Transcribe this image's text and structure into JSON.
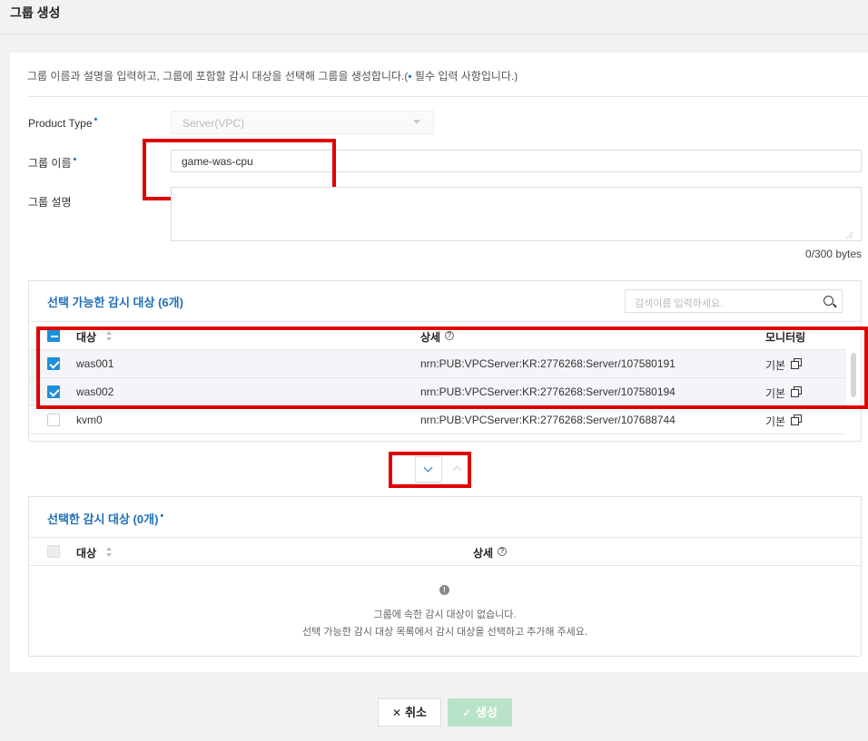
{
  "page": {
    "title": "그룹 생성",
    "description": "그룹 이름과 설명을 입력하고, 그룹에 포함할 감시 대상을 선택해 그룹을 생성합니다.(",
    "description_dot": "•",
    "description_tail": " 필수 입력 사항입니다.)"
  },
  "form": {
    "product_type_label": "Product Type",
    "product_type_value": "Server(VPC)",
    "group_name_label": "그룹 이름",
    "group_name_value": "game-was-cpu",
    "group_desc_label": "그룹 설명",
    "group_desc_value": "",
    "bytes_counter": "0/300 bytes",
    "required_mark": "•"
  },
  "available": {
    "title": "선택 가능한 감시 대상 (6개)",
    "search_placeholder": "검색이름 입력하세요.",
    "headers": {
      "target": "대상",
      "detail": "상세",
      "monitoring": "모니터링"
    },
    "rows": [
      {
        "name": "was001",
        "detail": "nrn:PUB:VPCServer:KR:2776268:Server/107580191",
        "monitoring": "기본",
        "checked": true
      },
      {
        "name": "was002",
        "detail": "nrn:PUB:VPCServer:KR:2776268:Server/107580194",
        "monitoring": "기본",
        "checked": true
      },
      {
        "name": "kvm0",
        "detail": "nrn:PUB:VPCServer:KR:2776268:Server/107688744",
        "monitoring": "기본",
        "checked": false
      }
    ]
  },
  "selected": {
    "title": "선택한 감시 대상 (0개)",
    "headers": {
      "target": "대상",
      "detail": "상세"
    },
    "empty_line1": "그룹에 속한 감시 대상이 없습니다.",
    "empty_line2": "선택 가능한 감시 대상 목록에서 감시 대상을 선택하고 추가해 주세요."
  },
  "buttons": {
    "cancel": "취소",
    "create": "생성"
  },
  "icons": {
    "help": "?",
    "info": "!",
    "close": "✕",
    "check": "✓"
  }
}
